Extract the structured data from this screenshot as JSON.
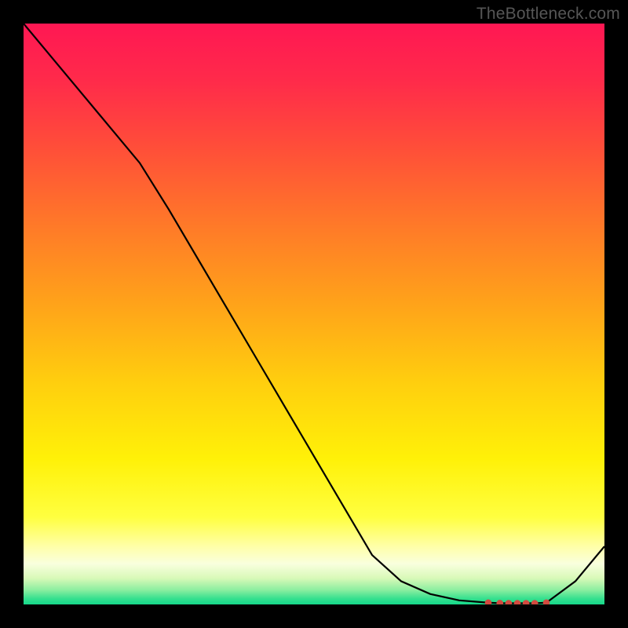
{
  "watermark": "TheBottleneck.com",
  "chart_data": {
    "type": "line",
    "x": [
      0.0,
      0.05,
      0.1,
      0.15,
      0.2,
      0.25,
      0.3,
      0.35,
      0.4,
      0.45,
      0.5,
      0.55,
      0.6,
      0.65,
      0.7,
      0.75,
      0.8,
      0.82,
      0.84,
      0.86,
      0.88,
      0.9,
      0.95,
      1.0
    ],
    "values": [
      1.0,
      0.94,
      0.88,
      0.82,
      0.76,
      0.68,
      0.595,
      0.51,
      0.425,
      0.34,
      0.255,
      0.17,
      0.085,
      0.04,
      0.018,
      0.007,
      0.003,
      0.0022,
      0.002,
      0.002,
      0.002,
      0.003,
      0.04,
      0.1
    ],
    "marker_points": [
      {
        "x": 0.8,
        "y": 0.003
      },
      {
        "x": 0.82,
        "y": 0.0022
      },
      {
        "x": 0.835,
        "y": 0.002
      },
      {
        "x": 0.85,
        "y": 0.002
      },
      {
        "x": 0.865,
        "y": 0.002
      },
      {
        "x": 0.88,
        "y": 0.002
      },
      {
        "x": 0.9,
        "y": 0.003
      }
    ],
    "title": "",
    "xlabel": "",
    "ylabel": "",
    "xlim": [
      0,
      1
    ],
    "ylim": [
      0,
      1
    ],
    "background_gradient": {
      "stops": [
        {
          "offset": 0.0,
          "color": "#ff1753"
        },
        {
          "offset": 0.1,
          "color": "#ff2b4a"
        },
        {
          "offset": 0.22,
          "color": "#ff5038"
        },
        {
          "offset": 0.35,
          "color": "#ff7a28"
        },
        {
          "offset": 0.48,
          "color": "#ffa21a"
        },
        {
          "offset": 0.62,
          "color": "#ffcf0e"
        },
        {
          "offset": 0.75,
          "color": "#fff108"
        },
        {
          "offset": 0.85,
          "color": "#ffff40"
        },
        {
          "offset": 0.9,
          "color": "#ffffa8"
        },
        {
          "offset": 0.93,
          "color": "#f9ffde"
        },
        {
          "offset": 0.955,
          "color": "#d8f9b8"
        },
        {
          "offset": 0.975,
          "color": "#8ceea0"
        },
        {
          "offset": 0.99,
          "color": "#35e08f"
        },
        {
          "offset": 1.0,
          "color": "#15d98a"
        }
      ]
    },
    "line_color": "#000000",
    "marker_color": "#d24a3f",
    "axes_visible": false,
    "grid": false
  }
}
